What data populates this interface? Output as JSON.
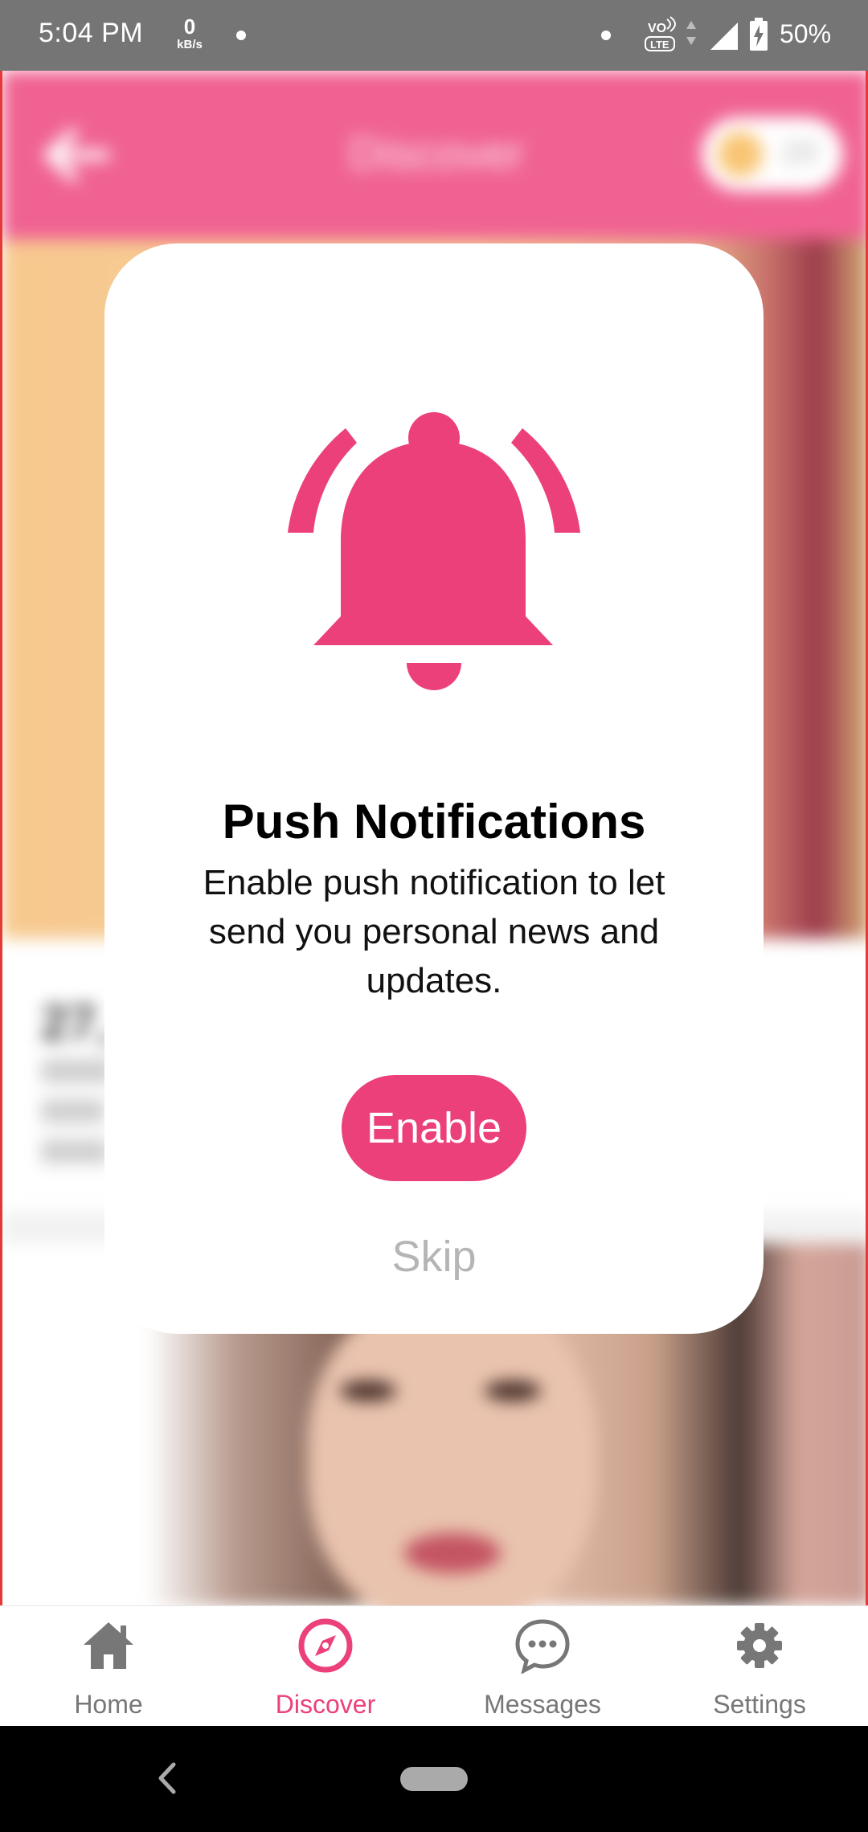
{
  "status_bar": {
    "time": "5:04 PM",
    "data_rate_value": "0",
    "data_rate_unit": "kB/s",
    "battery": "50%",
    "icons": [
      "dot-icon",
      "volte-lte-icon",
      "data-arrows-icon",
      "signal-icon",
      "battery-charging-icon"
    ]
  },
  "header": {
    "title": "Discover",
    "coins": "20",
    "back_icon": "back-arrow-icon",
    "coin_icon": "coin-icon"
  },
  "background_card": {
    "name": "27,"
  },
  "modal": {
    "icon": "bell-icon",
    "title": "Push Notifications",
    "description": "Enable push notification to let send you personal news and updates.",
    "enable_label": "Enable",
    "skip_label": "Skip"
  },
  "bottom_nav": {
    "items": [
      {
        "label": "Home",
        "icon": "home-icon",
        "active": false
      },
      {
        "label": "Discover",
        "icon": "compass-icon",
        "active": true
      },
      {
        "label": "Messages",
        "icon": "chat-bubble-icon",
        "active": false
      },
      {
        "label": "Settings",
        "icon": "gear-icon",
        "active": false
      }
    ]
  },
  "colors": {
    "accent": "#ec407a",
    "header": "#f06292",
    "status_bar": "#757575",
    "skip_text": "#b5b5b5"
  }
}
